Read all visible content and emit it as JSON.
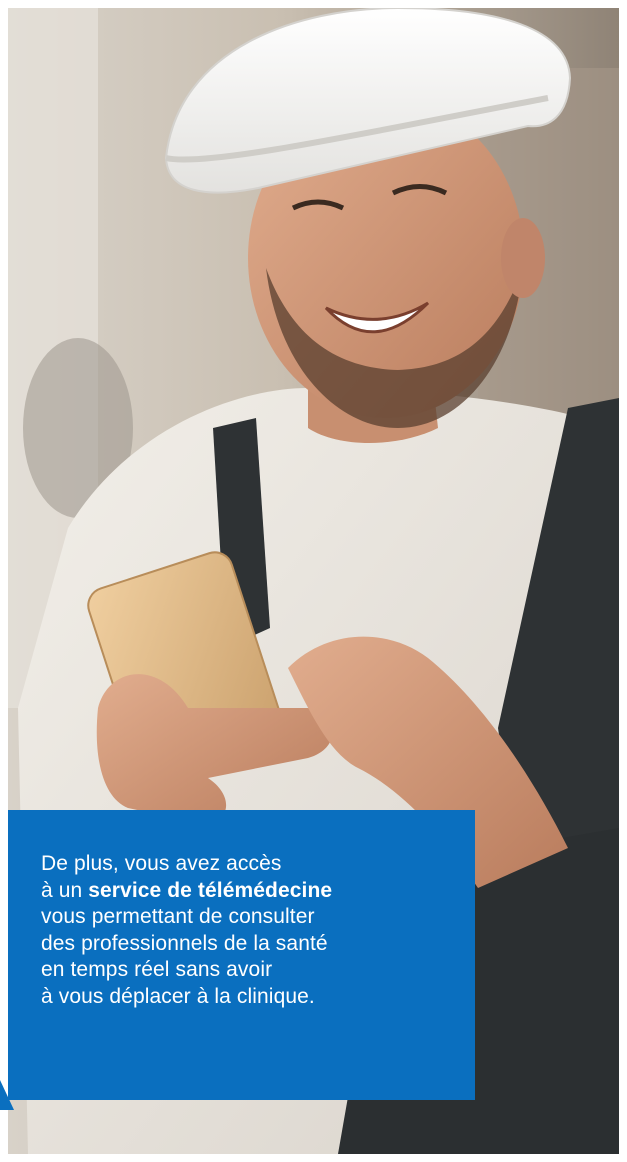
{
  "colors": {
    "panel_background": "#0a6fbf",
    "panel_text": "#ffffff",
    "page_background": "#ffffff"
  },
  "photo": {
    "subject": "smiling-worker-with-hard-hat-using-smartphone"
  },
  "text_panel": {
    "line1": "De plus, vous avez accès",
    "line2_prefix": "à un ",
    "line2_bold": "service de télémédecine",
    "line3": "vous permettant de consulter",
    "line4": "des professionnels de la santé",
    "line5": "en temps réel sans avoir",
    "line6": "à vous déplacer à la clinique."
  }
}
